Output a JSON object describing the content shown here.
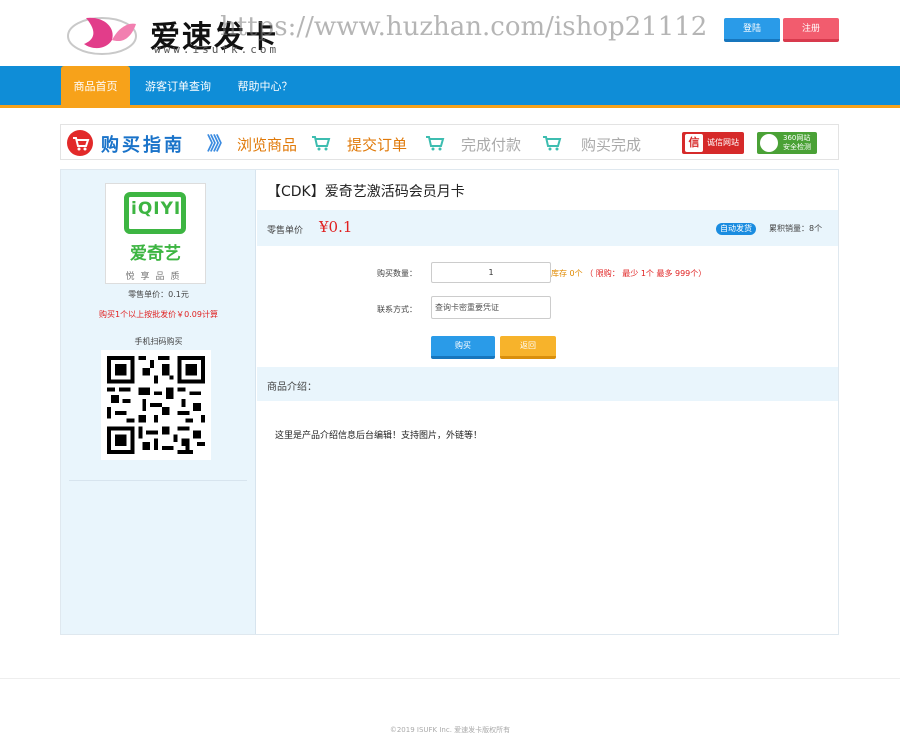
{
  "header": {
    "logo_title": "爱速发卡",
    "logo_sub": "www.isufk.com",
    "watermark": "https://www.huzhan.com/ishop21112",
    "login_label": "登陆",
    "register_label": "注册"
  },
  "nav": {
    "items": [
      {
        "label": "商品首页"
      },
      {
        "label": "游客订单查询"
      },
      {
        "label": "帮助中心？"
      }
    ]
  },
  "guide": {
    "title": "购买指南",
    "arrows": "》》",
    "steps": [
      "浏览商品",
      "提交订单",
      "完成付款",
      "购买完成"
    ],
    "badge_xin_glyph": "信",
    "badge_xin": "诚信网站",
    "badge_360_line1": "360网站",
    "badge_360_line2": "安全检测"
  },
  "left": {
    "logo_text": "iQIYI",
    "logo_cn": "爱奇艺",
    "slogan": "悦享品质",
    "price_text": "零售单价：0.1元",
    "wholesale_text": "购买1个以上按批发价￥0.09计算",
    "mobile_text": "手机扫码购买"
  },
  "product": {
    "title": "【CDK】爱奇艺激活码会员月卡",
    "price_label": "零售单价",
    "price_value": "¥0.1",
    "auto_badge": "自动发货",
    "sales": "累积销量：8个"
  },
  "form": {
    "qty_label": "购买数量：",
    "qty_value": "1",
    "stock_text": "库存 0个",
    "limit_text": "（ 限购： 最少 1个 最多 999个）",
    "contact_label": "联系方式：",
    "contact_placeholder": "查询卡密重要凭证",
    "buy_label": "购买",
    "back_label": "返回"
  },
  "intro": {
    "label": "商品介绍：",
    "text": "这里是产品介绍信息后台编辑！支持图片，外链等！"
  },
  "footer": {
    "text": "©2019 ISUFK Inc. 爱速发卡版权所有"
  },
  "colors": {
    "nav_blue": "#0f8dd7",
    "accent_orange": "#f7a21a",
    "price_red": "#e02020",
    "brand_green": "#3db542"
  }
}
